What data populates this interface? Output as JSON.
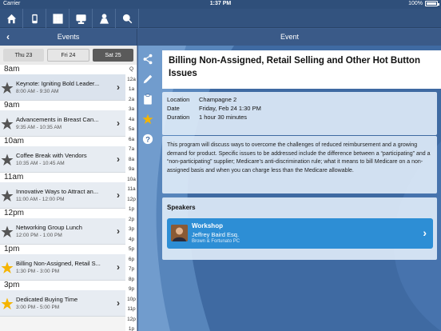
{
  "status": {
    "carrier": "Carrier",
    "time": "1:37 PM",
    "battery": "100%",
    "battery_level": 1.0
  },
  "nav": {
    "icons": [
      "home-icon",
      "phone-icon",
      "grid-icon",
      "presentation-icon",
      "user-icon",
      "search-icon"
    ]
  },
  "left_header": {
    "title": "Events"
  },
  "right_header": {
    "title": "Event"
  },
  "day_tabs": [
    {
      "label": "Thu 23"
    },
    {
      "label": "Fri 24"
    },
    {
      "label": "Sat 25"
    }
  ],
  "schedule": {
    "h8": "8am",
    "h9": "9am",
    "h10": "10am",
    "h11": "11am",
    "h12": "12pm",
    "h1": "1pm",
    "h3": "3pm",
    "events": [
      {
        "title": "Keynote: Igniting Bold Leader...",
        "time": "8:00 AM - 9:30 AM",
        "star": "gray"
      },
      {
        "title": "Advancements in Breast Can...",
        "time": "9:35 AM - 10:35 AM",
        "star": "gray"
      },
      {
        "title": "Coffee Break with Vendors",
        "time": "10:35 AM - 10:45 AM",
        "star": "gray"
      },
      {
        "title": "Innovative Ways to Attract an...",
        "time": "11:00 AM - 12:00 PM",
        "star": "gray"
      },
      {
        "title": "Networking Group Lunch",
        "time": "12:00 PM - 1:00 PM",
        "star": "gray"
      },
      {
        "title": "Billing Non-Assigned, Retail S...",
        "time": "1:30 PM - 3:00 PM",
        "star": "gold"
      },
      {
        "title": "Dedicated Buying Time",
        "time": "3:00 PM - 5:00 PM",
        "star": "gold"
      }
    ]
  },
  "index_labels": [
    "Q",
    "12a",
    "1a",
    "2a",
    "3a",
    "4a",
    "5a",
    "6a",
    "7a",
    "8a",
    "9a",
    "10a",
    "11a",
    "12p",
    "1p",
    "2p",
    "3p",
    "4p",
    "5p",
    "6p",
    "7p",
    "8p",
    "9p",
    "10p",
    "11p",
    "12p",
    "1p"
  ],
  "tools": [
    "share-icon",
    "edit-icon",
    "clipboard-icon",
    "star-icon",
    "help-icon"
  ],
  "colors": {
    "accent": "#2d8ed5",
    "star_gold": "#f5b400",
    "star_gray": "#555555"
  },
  "event": {
    "title": "Billing Non-Assigned, Retail Selling and Other Hot Button Issues",
    "location_label": "Location",
    "location": "Champagne 2",
    "date_label": "Date",
    "date": "Friday, Feb 24 1:30 PM",
    "duration_label": "Duration",
    "duration": "1 hour 30 minutes",
    "description": "This program will discuss ways to overcome the challenges of reduced reimbursement and a growing demand for product. Specific issues to be addressed include the difference between a “participating” and a “non-participating” supplier; Medicare’s anti-discrimination rule; what it means to bill Medicare on a non-assigned basis and when you can charge less than the Medicare allowable.",
    "speakers_label": "Speakers",
    "speaker": {
      "session": "Workshop",
      "name": "Jeffrey Baird Esq.",
      "org": "Brown & Fortunato PC"
    }
  }
}
